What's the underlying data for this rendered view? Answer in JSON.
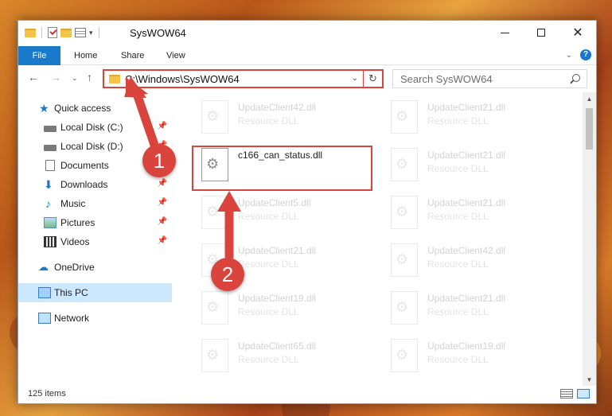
{
  "window": {
    "title": "SysWOW64"
  },
  "ribbon": {
    "tabs": [
      "File",
      "Home",
      "Share",
      "View"
    ]
  },
  "navigation": {
    "address": "C:\\Windows\\SysWOW64",
    "search_placeholder": "Search SysWOW64"
  },
  "sidebar": {
    "items": [
      {
        "label": "Quick access",
        "icon": "star-icon"
      },
      {
        "label": "Local Disk (C:)",
        "icon": "disk-icon",
        "pinned": true
      },
      {
        "label": "Local Disk (D:)",
        "icon": "disk-icon",
        "pinned": true
      },
      {
        "label": "Documents",
        "icon": "documents-icon",
        "pinned": true
      },
      {
        "label": "Downloads",
        "icon": "downloads-icon",
        "pinned": true
      },
      {
        "label": "Music",
        "icon": "music-icon",
        "pinned": true
      },
      {
        "label": "Pictures",
        "icon": "pictures-icon",
        "pinned": true
      },
      {
        "label": "Videos",
        "icon": "videos-icon",
        "pinned": true
      },
      {
        "label": "OneDrive",
        "icon": "onedrive-icon"
      },
      {
        "label": "This PC",
        "icon": "this-pc-icon",
        "selected": true
      },
      {
        "label": "Network",
        "icon": "network-icon"
      }
    ]
  },
  "files": {
    "highlighted": {
      "name": "c166_can_status.dll"
    },
    "left_column": [
      {
        "name": "UpdateClient42.dll",
        "desc": "Resource DLL"
      },
      {
        "name": "UpdateClient5.dll",
        "desc": "Resource DLL"
      },
      {
        "name": "UpdateClient21.dll",
        "desc": "Resource DLL"
      },
      {
        "name": "UpdateClient19.dll",
        "desc": "Resource DLL"
      },
      {
        "name": "UpdateClient65.dll",
        "desc": "Resource DLL"
      }
    ],
    "right_column": [
      {
        "name": "UpdateClient21.dll",
        "desc": "Resource DLL"
      },
      {
        "name": "UpdateClient21.dll",
        "desc": "Resource DLL"
      },
      {
        "name": "UpdateClient21.dll",
        "desc": "Resource DLL"
      },
      {
        "name": "UpdateClient42.dll",
        "desc": "Resource DLL"
      },
      {
        "name": "UpdateClient21.dll",
        "desc": "Resource DLL"
      },
      {
        "name": "UpdateClient19.dll",
        "desc": "Resource DLL"
      }
    ]
  },
  "status": {
    "item_count": "125 items"
  },
  "annotations": {
    "step1": "1",
    "step2": "2",
    "accent_color": "#d9453c"
  }
}
